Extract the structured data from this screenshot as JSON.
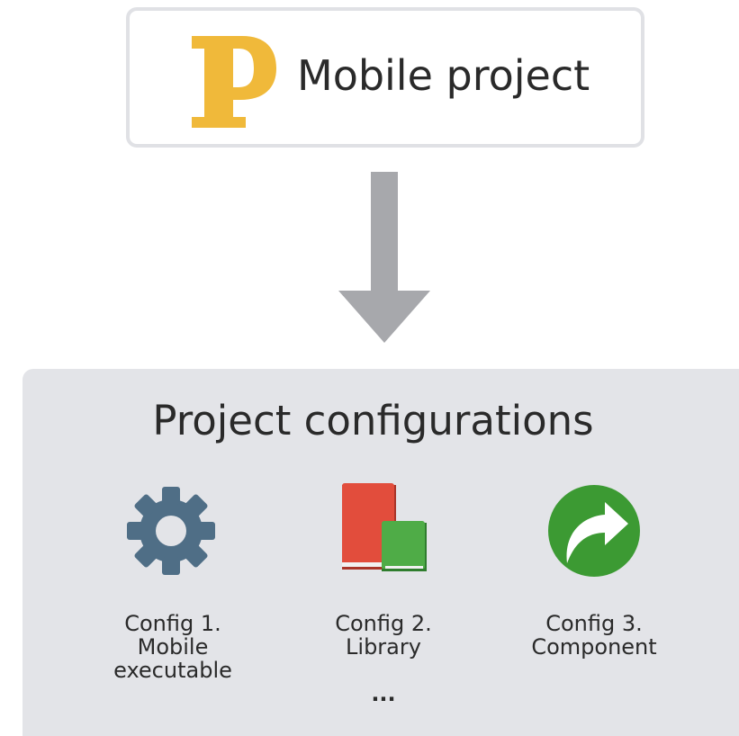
{
  "project": {
    "logo_letter": "P",
    "title": "Mobile project",
    "logo_color": "#f0b93a"
  },
  "arrow": {
    "color": "#a7a8ac"
  },
  "configurations": {
    "title": "Project configurations",
    "panel_color": "#e3e4e8",
    "items": [
      {
        "icon": "gear-icon",
        "icon_color": "#4f6e86",
        "line1": "Config 1.",
        "line2": "Mobile",
        "line3": "executable"
      },
      {
        "icon": "books-icon",
        "icon_colors": [
          "#e24d3c",
          "#4fac47"
        ],
        "line1": "Config 2.",
        "line2": "Library"
      },
      {
        "icon": "arrow-circle-icon",
        "icon_color": "#3c9a33",
        "line1": "Config 3.",
        "line2": "Component"
      }
    ],
    "ellipsis": "..."
  }
}
